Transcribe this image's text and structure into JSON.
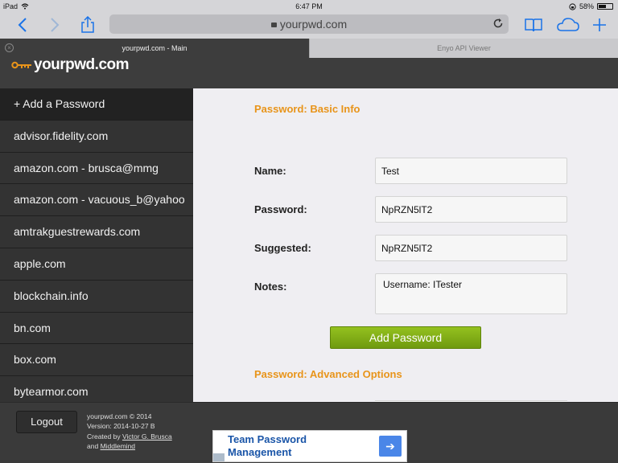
{
  "status_bar": {
    "device": "iPad",
    "time": "6:47 PM",
    "battery": "58%",
    "battery_level": 0.58
  },
  "browser": {
    "url": "yourpwd.com",
    "tabs": [
      {
        "label": "yourpwd.com - Main",
        "active": true
      },
      {
        "label": "Enyo API Viewer",
        "active": false
      }
    ]
  },
  "site": {
    "logo": "yourpwd.com"
  },
  "sidebar": {
    "items": [
      {
        "label": "+ Add a Password"
      },
      {
        "label": "advisor.fidelity.com"
      },
      {
        "label": "amazon.com - brusca@mmg"
      },
      {
        "label": "amazon.com - vacuous_b@yahoo"
      },
      {
        "label": "amtrakguestrewards.com"
      },
      {
        "label": "apple.com"
      },
      {
        "label": "blockchain.info"
      },
      {
        "label": "bn.com"
      },
      {
        "label": "box.com"
      },
      {
        "label": "bytearmor.com"
      }
    ]
  },
  "form": {
    "basic_title": "Password: Basic Info",
    "name_label": "Name:",
    "name_value": "Test",
    "password_label": "Password:",
    "password_value": "NpRZN5lT2",
    "suggested_label": "Suggested:",
    "suggested_value": "NpRZN5lT2",
    "notes_label": "Notes:",
    "notes_value": "Username: ITester",
    "add_button": "Add Password",
    "advanced_title": "Password: Advanced Options"
  },
  "footer": {
    "logout": "Logout",
    "copyright": "yourpwd.com © 2014",
    "version": "Version: 2014-10-27 B",
    "created_by": "Created by",
    "author": "Victor G. Brusca",
    "and": "and",
    "company": "Middlemind"
  },
  "ad": {
    "title": "Team Password Management"
  },
  "colors": {
    "accent": "#e8941a",
    "button": "#7fab14",
    "sidebar": "#333333",
    "link": "#1a73e8"
  }
}
